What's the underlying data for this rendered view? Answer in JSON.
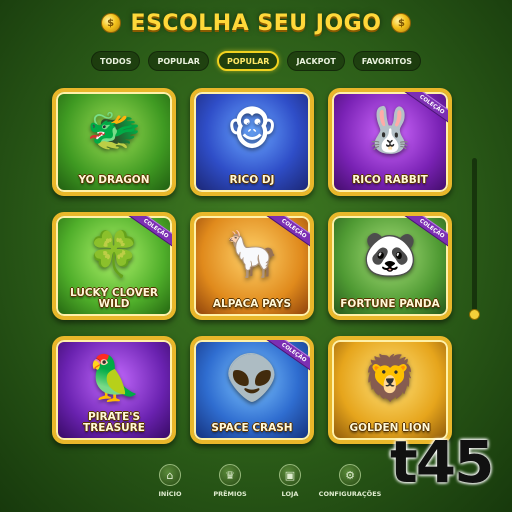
{
  "header": {
    "title": "ESCOLHA SEU JOGO",
    "left_icon": "coin-icon",
    "right_icon": "coin-icon"
  },
  "tabs": [
    {
      "label": "TODOS",
      "active": false
    },
    {
      "label": "POPULAR",
      "active": false
    },
    {
      "label": "POPULAR",
      "active": true
    },
    {
      "label": "JACKPOT",
      "active": false
    },
    {
      "label": "FAVORITOS",
      "active": false
    }
  ],
  "games": [
    {
      "name": "YO DRAGON",
      "icon": "dragon-icon",
      "badge": ""
    },
    {
      "name": "RICO DJ",
      "icon": "monkey-dj-icon",
      "badge": ""
    },
    {
      "name": "RICO RABBIT",
      "icon": "rabbit-icon",
      "badge": "COLEÇÃO"
    },
    {
      "name": "LUCKY CLOVER WILD",
      "icon": "clover-icon",
      "badge": "COLEÇÃO"
    },
    {
      "name": "ALPACA PAYS",
      "icon": "alpaca-icon",
      "badge": "COLEÇÃO"
    },
    {
      "name": "FORTUNE PANDA",
      "icon": "panda-icon",
      "badge": "COLEÇÃO"
    },
    {
      "name": "PIRATE'S TREASURE",
      "icon": "parrot-icon",
      "badge": ""
    },
    {
      "name": "SPACE CRASH",
      "icon": "alien-icon",
      "badge": "COLEÇÃO"
    },
    {
      "name": "GOLDEN LION",
      "icon": "lion-icon",
      "badge": ""
    }
  ],
  "nav": [
    {
      "label": "INÍCIO",
      "icon": "home-icon"
    },
    {
      "label": "PRÊMIOS",
      "icon": "trophy-icon"
    },
    {
      "label": "LOJA",
      "icon": "shop-icon"
    },
    {
      "label": "CONFIGURAÇÕES",
      "icon": "gear-icon"
    }
  ],
  "watermark": "t45",
  "colors": {
    "gold": "#e9b72a",
    "active_tab": "#f2d21f",
    "badge": "#7c2fb3",
    "background": "#2b5c18"
  }
}
